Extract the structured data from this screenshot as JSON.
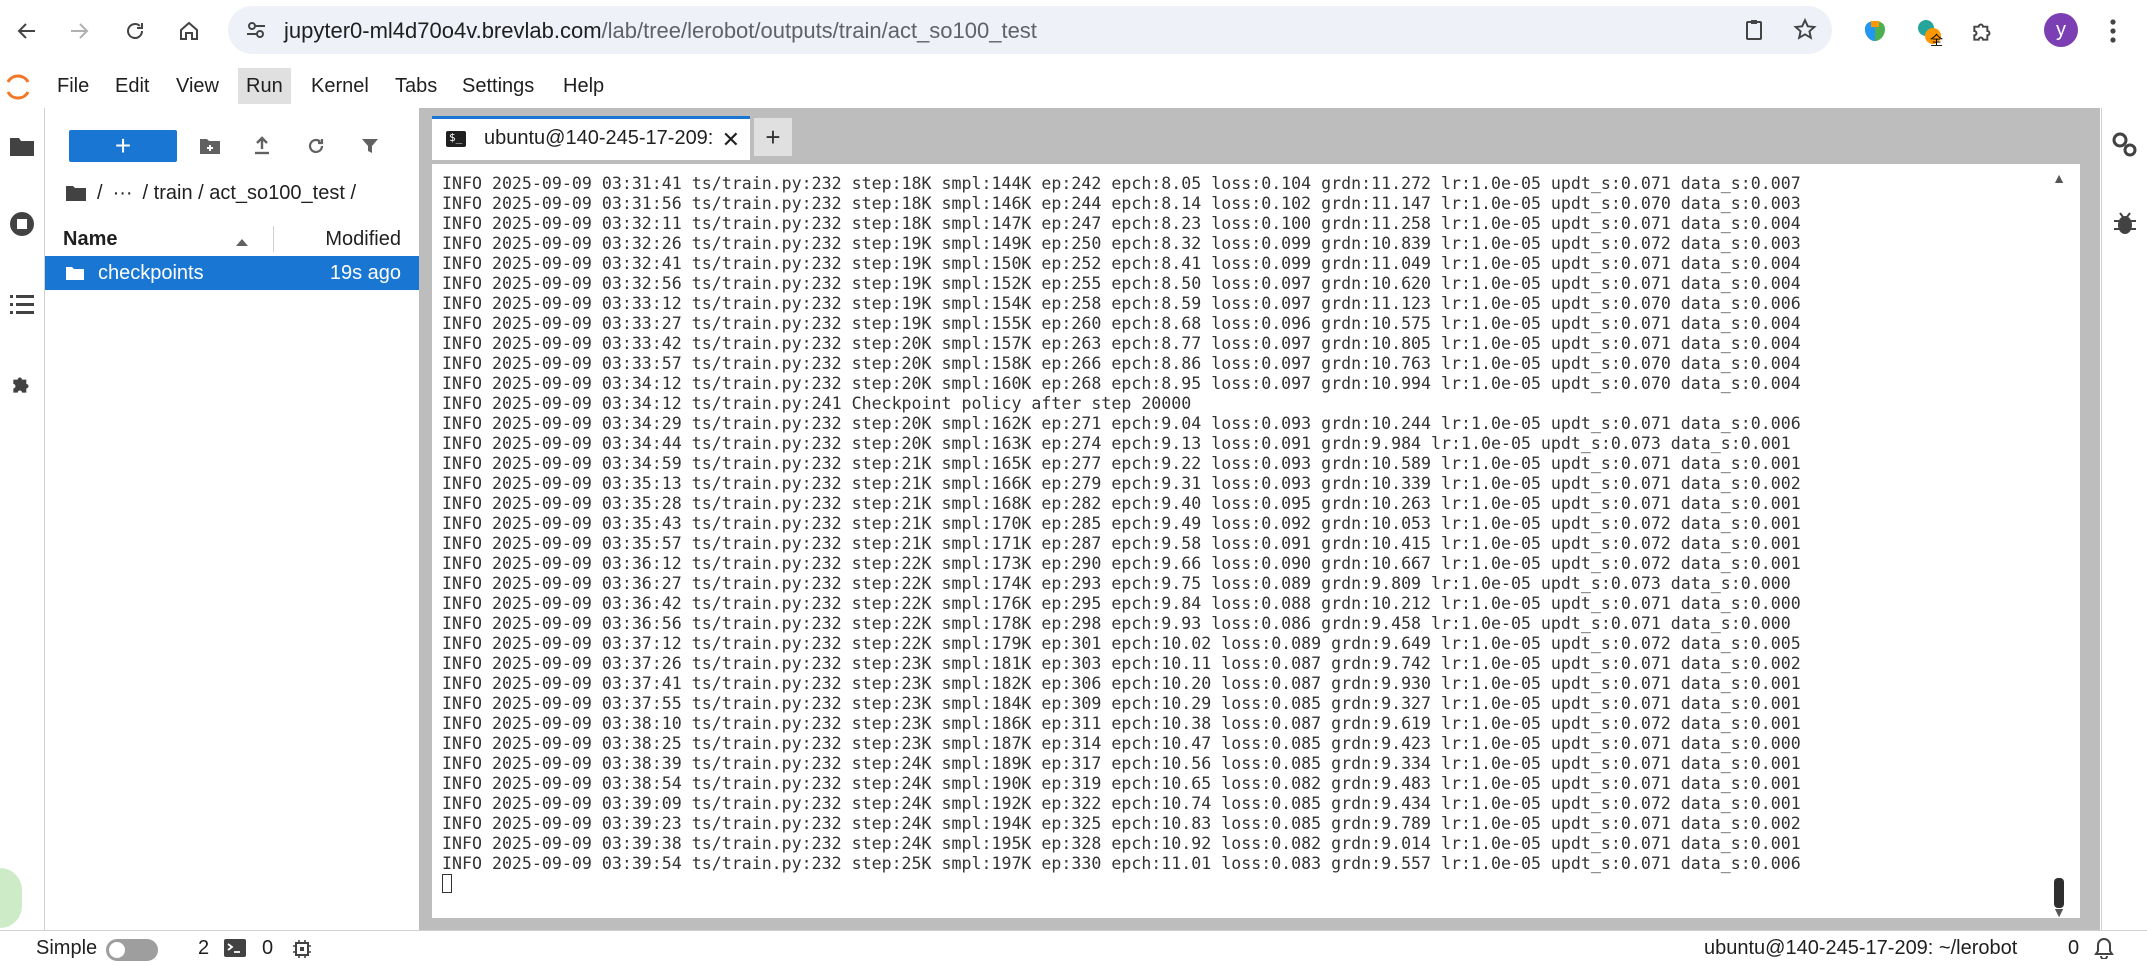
{
  "browser": {
    "url_host": "jupyter0-ml4d70o4v.brevlab.com",
    "url_path": "/lab/tree/lerobot/outputs/train/act_so100_test",
    "profile_initial": "y",
    "ext_badge": "全"
  },
  "menubar": {
    "items": [
      "File",
      "Edit",
      "View",
      "Run",
      "Kernel",
      "Tabs",
      "Settings",
      "Help"
    ],
    "active": "Run"
  },
  "filebrowser": {
    "new_label": "+",
    "breadcrumb": {
      "root": "/",
      "ellipsis": "···",
      "path": "/ train / act_so100_test /"
    },
    "columns": {
      "name": "Name",
      "modified": "Modified"
    },
    "rows": [
      {
        "name": "checkpoints",
        "modified": "19s ago",
        "selected": true
      }
    ]
  },
  "tabs": {
    "active_title": "ubuntu@140-245-17-209:",
    "icon_text": "$_",
    "close": "✕",
    "add": "+"
  },
  "terminal": {
    "lines": [
      "INFO 2025-09-09 03:31:41 ts/train.py:232 step:18K smpl:144K ep:242 epch:8.05 loss:0.104 grdn:11.272 lr:1.0e-05 updt_s:0.071 data_s:0.007",
      "INFO 2025-09-09 03:31:56 ts/train.py:232 step:18K smpl:146K ep:244 epch:8.14 loss:0.102 grdn:11.147 lr:1.0e-05 updt_s:0.070 data_s:0.003",
      "INFO 2025-09-09 03:32:11 ts/train.py:232 step:18K smpl:147K ep:247 epch:8.23 loss:0.100 grdn:11.258 lr:1.0e-05 updt_s:0.071 data_s:0.004",
      "INFO 2025-09-09 03:32:26 ts/train.py:232 step:19K smpl:149K ep:250 epch:8.32 loss:0.099 grdn:10.839 lr:1.0e-05 updt_s:0.072 data_s:0.003",
      "INFO 2025-09-09 03:32:41 ts/train.py:232 step:19K smpl:150K ep:252 epch:8.41 loss:0.099 grdn:11.049 lr:1.0e-05 updt_s:0.071 data_s:0.004",
      "INFO 2025-09-09 03:32:56 ts/train.py:232 step:19K smpl:152K ep:255 epch:8.50 loss:0.097 grdn:10.620 lr:1.0e-05 updt_s:0.071 data_s:0.004",
      "INFO 2025-09-09 03:33:12 ts/train.py:232 step:19K smpl:154K ep:258 epch:8.59 loss:0.097 grdn:11.123 lr:1.0e-05 updt_s:0.070 data_s:0.006",
      "INFO 2025-09-09 03:33:27 ts/train.py:232 step:19K smpl:155K ep:260 epch:8.68 loss:0.096 grdn:10.575 lr:1.0e-05 updt_s:0.071 data_s:0.004",
      "INFO 2025-09-09 03:33:42 ts/train.py:232 step:20K smpl:157K ep:263 epch:8.77 loss:0.097 grdn:10.805 lr:1.0e-05 updt_s:0.071 data_s:0.004",
      "INFO 2025-09-09 03:33:57 ts/train.py:232 step:20K smpl:158K ep:266 epch:8.86 loss:0.097 grdn:10.763 lr:1.0e-05 updt_s:0.070 data_s:0.004",
      "INFO 2025-09-09 03:34:12 ts/train.py:232 step:20K smpl:160K ep:268 epch:8.95 loss:0.097 grdn:10.994 lr:1.0e-05 updt_s:0.070 data_s:0.004",
      "INFO 2025-09-09 03:34:12 ts/train.py:241 Checkpoint policy after step 20000",
      "INFO 2025-09-09 03:34:29 ts/train.py:232 step:20K smpl:162K ep:271 epch:9.04 loss:0.093 grdn:10.244 lr:1.0e-05 updt_s:0.071 data_s:0.006",
      "INFO 2025-09-09 03:34:44 ts/train.py:232 step:20K smpl:163K ep:274 epch:9.13 loss:0.091 grdn:9.984 lr:1.0e-05 updt_s:0.073 data_s:0.001",
      "INFO 2025-09-09 03:34:59 ts/train.py:232 step:21K smpl:165K ep:277 epch:9.22 loss:0.093 grdn:10.589 lr:1.0e-05 updt_s:0.071 data_s:0.001",
      "INFO 2025-09-09 03:35:13 ts/train.py:232 step:21K smpl:166K ep:279 epch:9.31 loss:0.093 grdn:10.339 lr:1.0e-05 updt_s:0.071 data_s:0.002",
      "INFO 2025-09-09 03:35:28 ts/train.py:232 step:21K smpl:168K ep:282 epch:9.40 loss:0.095 grdn:10.263 lr:1.0e-05 updt_s:0.071 data_s:0.001",
      "INFO 2025-09-09 03:35:43 ts/train.py:232 step:21K smpl:170K ep:285 epch:9.49 loss:0.092 grdn:10.053 lr:1.0e-05 updt_s:0.072 data_s:0.001",
      "INFO 2025-09-09 03:35:57 ts/train.py:232 step:21K smpl:171K ep:287 epch:9.58 loss:0.091 grdn:10.415 lr:1.0e-05 updt_s:0.072 data_s:0.001",
      "INFO 2025-09-09 03:36:12 ts/train.py:232 step:22K smpl:173K ep:290 epch:9.66 loss:0.090 grdn:10.667 lr:1.0e-05 updt_s:0.072 data_s:0.001",
      "INFO 2025-09-09 03:36:27 ts/train.py:232 step:22K smpl:174K ep:293 epch:9.75 loss:0.089 grdn:9.809 lr:1.0e-05 updt_s:0.073 data_s:0.000",
      "INFO 2025-09-09 03:36:42 ts/train.py:232 step:22K smpl:176K ep:295 epch:9.84 loss:0.088 grdn:10.212 lr:1.0e-05 updt_s:0.071 data_s:0.000",
      "INFO 2025-09-09 03:36:56 ts/train.py:232 step:22K smpl:178K ep:298 epch:9.93 loss:0.086 grdn:9.458 lr:1.0e-05 updt_s:0.071 data_s:0.000",
      "INFO 2025-09-09 03:37:12 ts/train.py:232 step:22K smpl:179K ep:301 epch:10.02 loss:0.089 grdn:9.649 lr:1.0e-05 updt_s:0.072 data_s:0.005",
      "INFO 2025-09-09 03:37:26 ts/train.py:232 step:23K smpl:181K ep:303 epch:10.11 loss:0.087 grdn:9.742 lr:1.0e-05 updt_s:0.071 data_s:0.002",
      "INFO 2025-09-09 03:37:41 ts/train.py:232 step:23K smpl:182K ep:306 epch:10.20 loss:0.087 grdn:9.930 lr:1.0e-05 updt_s:0.071 data_s:0.001",
      "INFO 2025-09-09 03:37:55 ts/train.py:232 step:23K smpl:184K ep:309 epch:10.29 loss:0.085 grdn:9.327 lr:1.0e-05 updt_s:0.071 data_s:0.001",
      "INFO 2025-09-09 03:38:10 ts/train.py:232 step:23K smpl:186K ep:311 epch:10.38 loss:0.087 grdn:9.619 lr:1.0e-05 updt_s:0.072 data_s:0.001",
      "INFO 2025-09-09 03:38:25 ts/train.py:232 step:23K smpl:187K ep:314 epch:10.47 loss:0.085 grdn:9.423 lr:1.0e-05 updt_s:0.071 data_s:0.000",
      "INFO 2025-09-09 03:38:39 ts/train.py:232 step:24K smpl:189K ep:317 epch:10.56 loss:0.085 grdn:9.334 lr:1.0e-05 updt_s:0.071 data_s:0.001",
      "INFO 2025-09-09 03:38:54 ts/train.py:232 step:24K smpl:190K ep:319 epch:10.65 loss:0.082 grdn:9.483 lr:1.0e-05 updt_s:0.071 data_s:0.001",
      "INFO 2025-09-09 03:39:09 ts/train.py:232 step:24K smpl:192K ep:322 epch:10.74 loss:0.085 grdn:9.434 lr:1.0e-05 updt_s:0.072 data_s:0.001",
      "INFO 2025-09-09 03:39:23 ts/train.py:232 step:24K smpl:194K ep:325 epch:10.83 loss:0.085 grdn:9.789 lr:1.0e-05 updt_s:0.071 data_s:0.002",
      "INFO 2025-09-09 03:39:38 ts/train.py:232 step:24K smpl:195K ep:328 epch:10.92 loss:0.082 grdn:9.014 lr:1.0e-05 updt_s:0.071 data_s:0.001",
      "INFO 2025-09-09 03:39:54 ts/train.py:232 step:25K smpl:197K ep:330 epch:11.01 loss:0.083 grdn:9.557 lr:1.0e-05 updt_s:0.071 data_s:0.006"
    ]
  },
  "statusbar": {
    "simple_label": "Simple",
    "simple_enabled": false,
    "terminal_count": "2",
    "kernel_count": "0",
    "context": "ubuntu@140-245-17-209: ~/lerobot",
    "notifications": "0"
  },
  "colors": {
    "accent": "#1976d2",
    "dock_bg": "#bdbdbd",
    "terminal_text": "#333333"
  }
}
